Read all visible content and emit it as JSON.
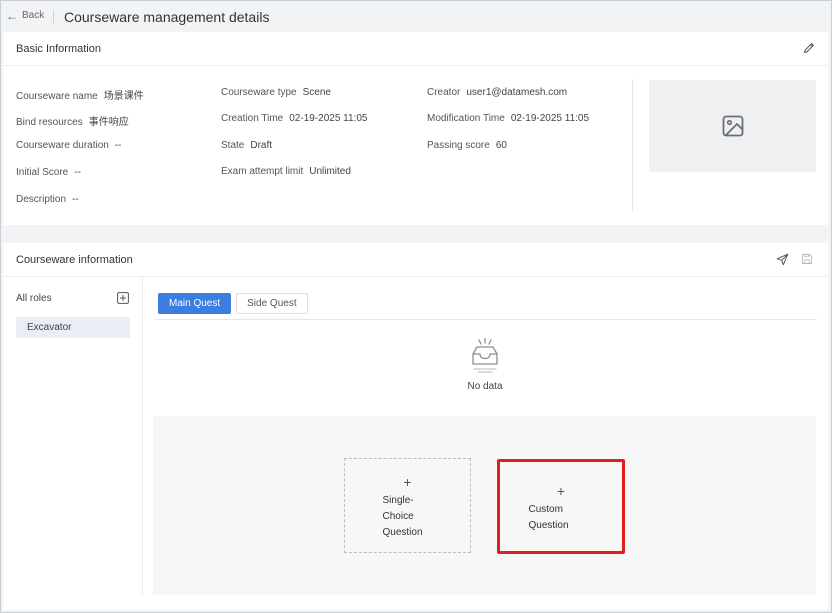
{
  "header": {
    "back_label": "Back",
    "page_title": "Courseware management details"
  },
  "basic": {
    "title": "Basic Information",
    "fields": {
      "courseware_name": {
        "label": "Courseware name",
        "value": "场景课件"
      },
      "courseware_type": {
        "label": "Courseware type",
        "value": "Scene"
      },
      "creator": {
        "label": "Creator",
        "value": "user1@datamesh.com"
      },
      "bind_resources": {
        "label": "Bind resources",
        "value": "事件响应"
      },
      "creation_time": {
        "label": "Creation Time",
        "value": "02-19-2025 11:05"
      },
      "modification_time": {
        "label": "Modification Time",
        "value": "02-19-2025 11:05"
      },
      "courseware_duration": {
        "label": "Courseware duration",
        "value": "--"
      },
      "state": {
        "label": "State",
        "value": "Draft"
      },
      "passing_score": {
        "label": "Passing score",
        "value": "60"
      },
      "initial_score": {
        "label": "Initial Score",
        "value": "--"
      },
      "exam_attempt_limit": {
        "label": "Exam attempt limit",
        "value": "Unlimited"
      },
      "description": {
        "label": "Description",
        "value": "--"
      }
    }
  },
  "info": {
    "title": "Courseware information",
    "roles_title": "All roles",
    "roles": [
      "Excavator"
    ],
    "tabs": [
      "Main Quest",
      "Side Quest"
    ],
    "active_tab": "Main Quest",
    "empty_text": "No data",
    "add_buttons": {
      "single_choice": "Single-Choice Question",
      "custom": "Custom Question"
    }
  },
  "colors": {
    "accent": "#3b7ee0",
    "highlight": "#e02020",
    "page_bg": "#f2f3f5"
  }
}
